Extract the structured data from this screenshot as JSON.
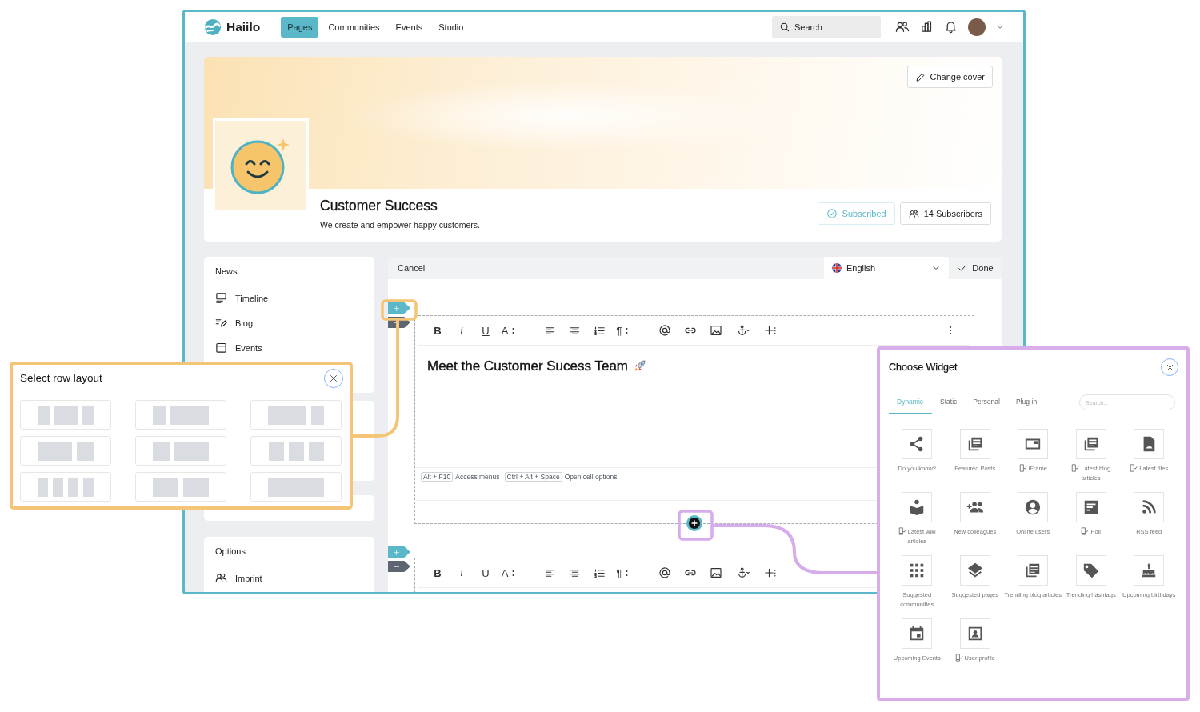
{
  "nav": {
    "logo": "Haiilo",
    "links": [
      {
        "label": "Pages",
        "selected": true
      },
      {
        "label": "Communities",
        "selected": false
      },
      {
        "label": "Events",
        "selected": false
      },
      {
        "label": "Studio",
        "selected": false
      }
    ],
    "search": {
      "placeholder": "Search"
    }
  },
  "header": {
    "change_cover": "Change cover",
    "title": "Customer Success",
    "description": "We create and empower happy customers.",
    "subscription": {
      "label": "Subscribed",
      "subscribed": true
    },
    "subscribers": "14 Subscribers"
  },
  "sidebar": {
    "groups": [
      {
        "title": "News",
        "items": [
          "Timeline",
          "Blog",
          "Events"
        ]
      },
      {
        "title": "Options",
        "items": [
          "Imprint"
        ]
      }
    ]
  },
  "editor": {
    "cancel": "Cancel",
    "language": "English",
    "done": "Done",
    "rows": [
      {
        "toolbar": [
          "B",
          "i",
          "U",
          "A",
          "¶"
        ],
        "heading": "Meet the Customer Sucess Team",
        "hints": [
          {
            "key": "Alt + F10",
            "text": "Access menus"
          },
          {
            "key": "Ctrl + Alt + Space",
            "text": "Open cell options"
          }
        ]
      },
      {
        "toolbar": [
          "B",
          "i",
          "U",
          "A",
          "¶"
        ]
      }
    ]
  },
  "row_layout_popup": {
    "title": "Select row layout"
  },
  "widget_panel": {
    "title": "Choose Widget",
    "tabs": [
      {
        "label": "Dynamic",
        "selected": true
      },
      {
        "label": "Static",
        "selected": false
      },
      {
        "label": "Personal",
        "selected": false
      },
      {
        "label": "Plug-in",
        "selected": false
      }
    ],
    "search": {
      "placeholder": "Search..."
    },
    "widgets": [
      {
        "label": "Do you know?",
        "mobile_ready": false
      },
      {
        "label": "Featured Posts",
        "mobile_ready": false
      },
      {
        "label": "iFrame",
        "mobile_ready": true
      },
      {
        "label": "Latest blog articles",
        "mobile_ready": true
      },
      {
        "label": "Latest files",
        "mobile_ready": true
      },
      {
        "label": "Latest wiki articles",
        "mobile_ready": true
      },
      {
        "label": "New colleagues",
        "mobile_ready": false
      },
      {
        "label": "Online users",
        "mobile_ready": false
      },
      {
        "label": "Poll",
        "mobile_ready": true
      },
      {
        "label": "RSS feed",
        "mobile_ready": false
      },
      {
        "label": "Suggested communities",
        "mobile_ready": false
      },
      {
        "label": "Suggested pages",
        "mobile_ready": false
      },
      {
        "label": "Trending blog articles",
        "mobile_ready": false
      },
      {
        "label": "Trending hashtags",
        "mobile_ready": false
      },
      {
        "label": "Upcoming birthdays",
        "mobile_ready": false
      },
      {
        "label": "Upcoming Events",
        "mobile_ready": false
      },
      {
        "label": "User profile",
        "mobile_ready": true
      }
    ]
  }
}
